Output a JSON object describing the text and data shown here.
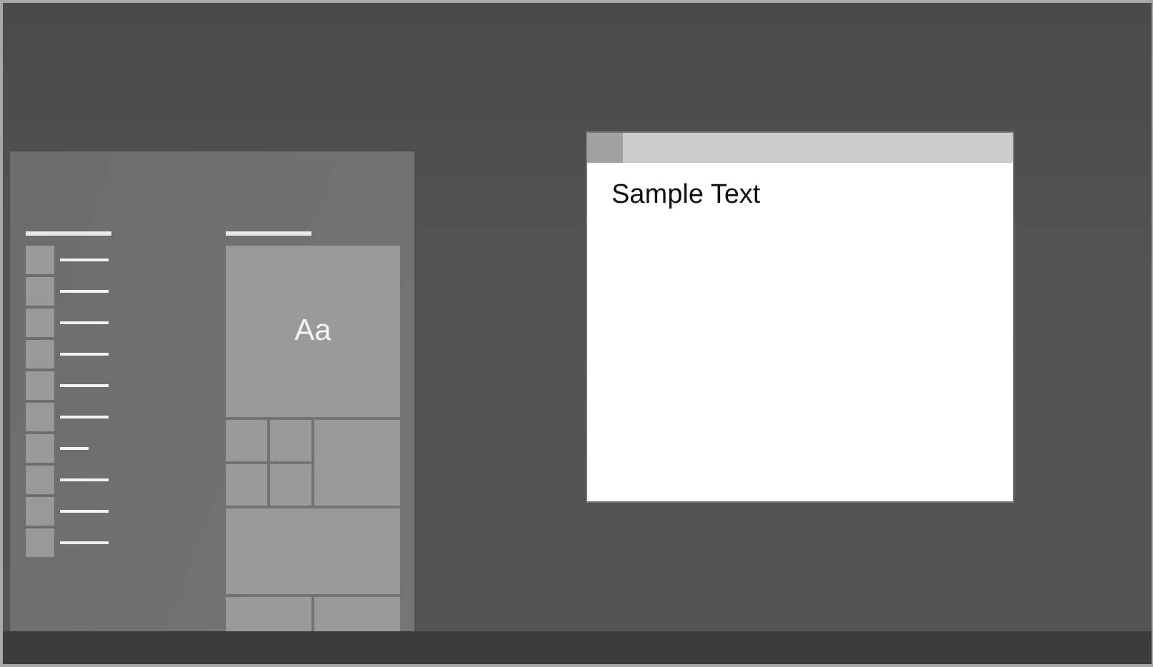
{
  "start_menu": {
    "tile_label": "Aa"
  },
  "window": {
    "text": "Sample Text"
  }
}
